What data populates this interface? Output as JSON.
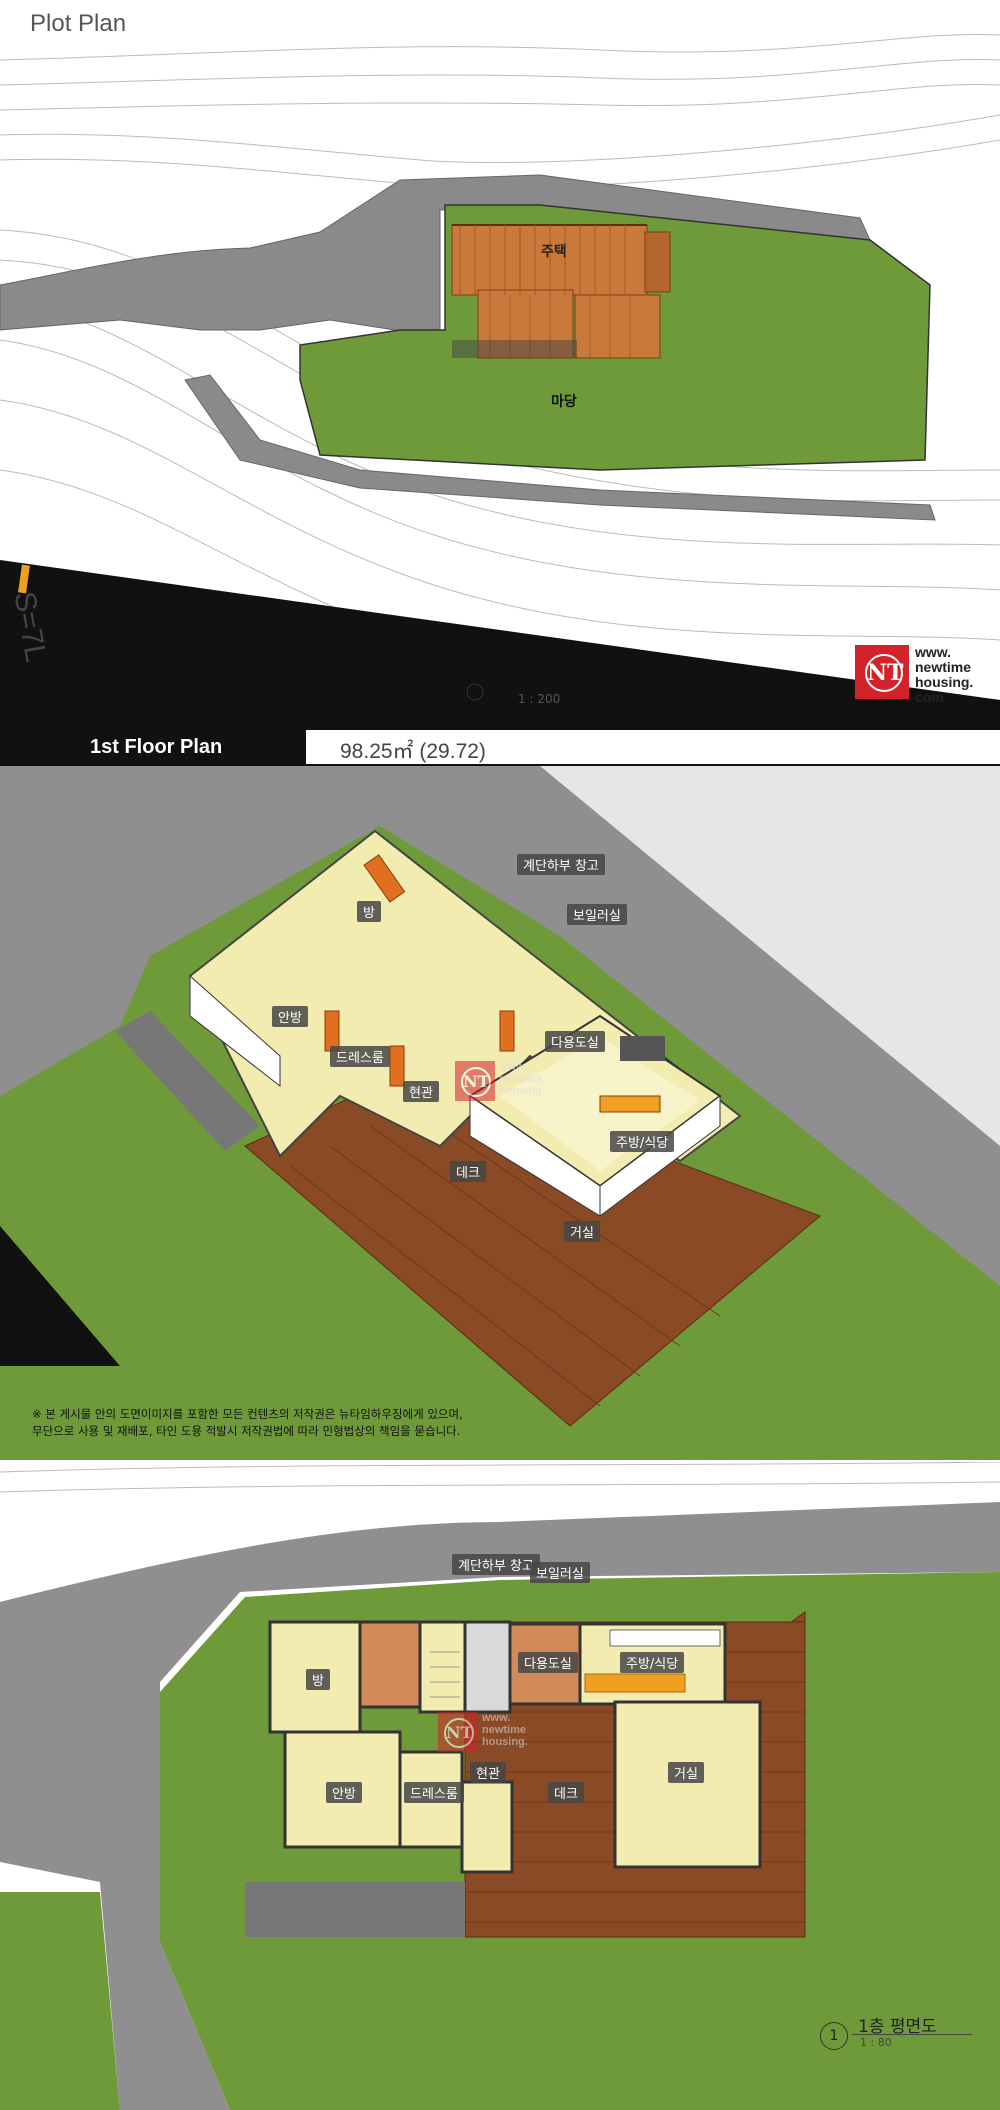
{
  "plot": {
    "title": "Plot Plan",
    "house_label": "주택",
    "yard_label": "마당",
    "road_label": "S=7L",
    "scale": "1 : 200"
  },
  "logo": {
    "letters": "NT",
    "line1": "www.",
    "line2": "newtime",
    "line3": "housing.",
    "line4": "com"
  },
  "floor_bar": {
    "label": "1st Floor Plan",
    "area": "98.25㎡ (29.72)"
  },
  "rooms": {
    "room": "방",
    "master": "안방",
    "dress": "드레스룸",
    "entry": "현관",
    "deck": "데크",
    "living": "거실",
    "kitchen": "주방/식당",
    "utility": "다용도실",
    "stair_storage": "계단하부 창고",
    "boiler": "보일러실"
  },
  "notice": {
    "line1": "※ 본 게시물 안의 도면이미지를 포함한 모든 컨텐츠의 저작권은 뉴타임하우징에게 있으며,",
    "line2": "무단으로 사용 및 재배포, 타인 도용 적발시 저작권법에 따라 민형법상의 책임을 묻습니다."
  },
  "caption": {
    "number": "1",
    "title": "1층 평면도",
    "scale": "1 : 80"
  },
  "colors": {
    "grass": "#6f9a3a",
    "road": "#8a8a8a",
    "roof": "#c9793a",
    "floor": "#f2ecb0",
    "deck": "#8a4a25",
    "logo_red": "#d3222a"
  }
}
